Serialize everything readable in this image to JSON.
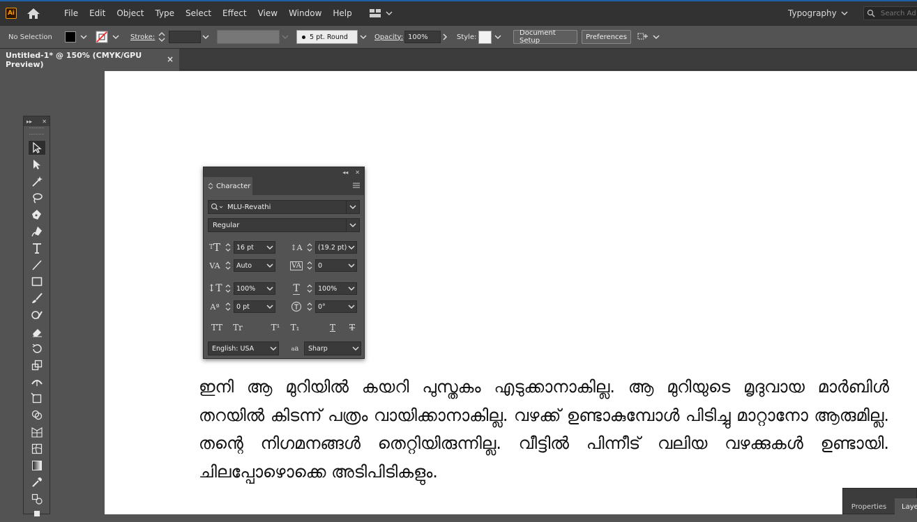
{
  "app": {
    "logo_text": "Ai"
  },
  "menu": [
    "File",
    "Edit",
    "Object",
    "Type",
    "Select",
    "Effect",
    "View",
    "Window",
    "Help"
  ],
  "workspace": {
    "label": "Typography"
  },
  "search": {
    "placeholder": "Search Ad"
  },
  "control_bar": {
    "selection": "No Selection",
    "stroke_label": "Stroke:",
    "brush": "5 pt. Round",
    "opacity_label": "Opacity:",
    "opacity_value": "100%",
    "style_label": "Style:",
    "document_setup": "Document Setup",
    "preferences": "Preferences"
  },
  "document_tab": {
    "title": "Untitled-1* @ 150% (CMYK/GPU Preview)",
    "close": "×"
  },
  "character_panel": {
    "tab": "Character",
    "font_family": "MLU-Revathi",
    "font_style": "Regular",
    "font_size": "16 pt",
    "leading": "(19.2 pt)",
    "kerning": "Auto",
    "tracking": "0",
    "vertical_scale": "100%",
    "horizontal_scale": "100%",
    "baseline_shift": "0 pt",
    "rotation": "0°",
    "language": "English: USA",
    "antialias_glyph": "a",
    "antialias": "Sharp",
    "format_buttons": [
      "TT",
      "Tr",
      "T¹",
      "T₁",
      "T",
      "T"
    ]
  },
  "artboard_text": "ഇനി ആ മുറിയിൽ കയറി പുസ്തകം എടുക്കാനാകില്ല. ആ മുറിയുടെ മൃദുവായ മാർബിൾ തറയിൽ കിടന്ന് പത്രം വായിക്കാനാകില്ല. വഴക്ക് ഉണ്ടാകുമ്പോൾ പിടിച്ചു മാറ്റാനോ ആരുമില്ല. തന്റെ നിഗമനങ്ങൾ തെറ്റിയിരുന്നില്ല. വീട്ടിൽ പിന്നീട് വലിയ വഴക്കുകൾ ഉണ്ടായി. ചിലപ്പോഴൊക്കെ അടിപിടികളും.",
  "bottom_panel": {
    "properties": "Properties",
    "layers": "Layers"
  },
  "colors": {
    "accent": "#1f5fa8",
    "logo": "#ff9a00",
    "fill_swatch": "#000000",
    "stroke_none": "#ff2020"
  }
}
